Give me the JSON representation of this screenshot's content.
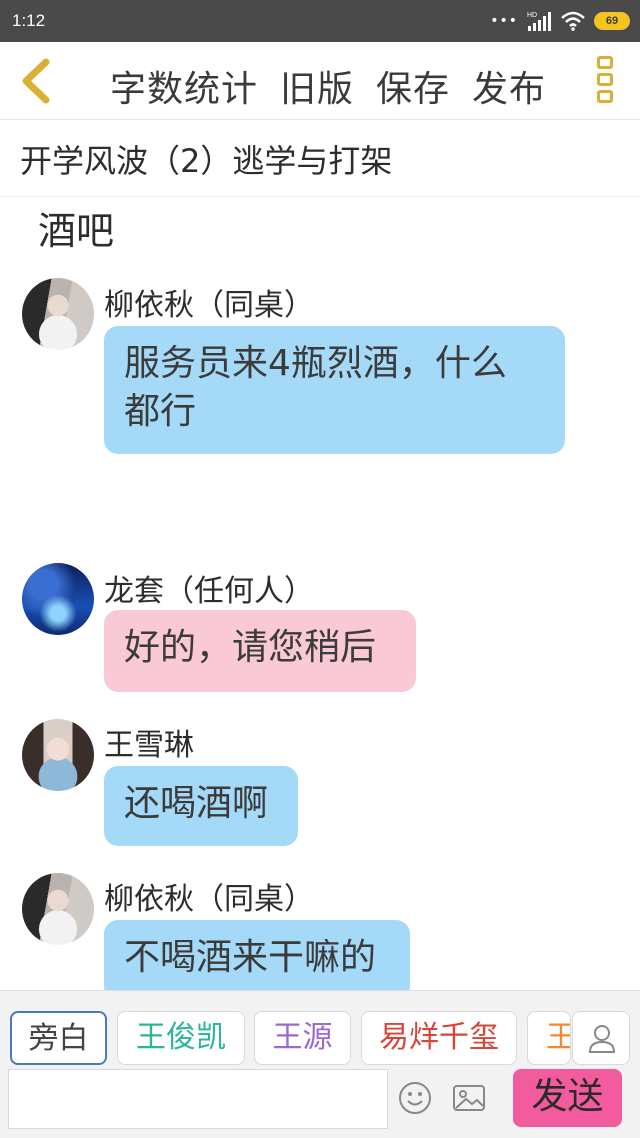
{
  "status_bar": {
    "time": "1:12",
    "signal": "HD",
    "battery": "69"
  },
  "toolbar": {
    "word_count": "字数统计",
    "old_version": "旧版",
    "save": "保存",
    "publish": "发布"
  },
  "chapter": {
    "title": "开学风波（2）逃学与打架"
  },
  "narration": "酒吧",
  "messages": [
    {
      "sender": "柳依秋（同桌）",
      "text": "服务员来4瓶烈酒，什么都行",
      "line1": "服务员来4瓶烈酒，什么",
      "line2": "都行",
      "color": "#a4d9f7"
    },
    {
      "sender": "龙套（任何人）",
      "text": "好的，请您稍后",
      "color": "#f9c9d6"
    },
    {
      "sender": "王雪琳",
      "text": "还喝酒啊",
      "color": "#a4d9f7"
    },
    {
      "sender": "柳依秋（同桌）",
      "text": "不喝酒来干嘛的",
      "color": "#a4d9f7"
    }
  ],
  "role_chips": [
    {
      "label": "旁白",
      "color": "#444444"
    },
    {
      "label": "王俊凯",
      "color": "#2bb59a"
    },
    {
      "label": "王源",
      "color": "#9b6ad0"
    },
    {
      "label": "易烊千玺",
      "color": "#d9443a"
    },
    {
      "label": "王",
      "color": "#f08a30"
    }
  ],
  "input": {
    "placeholder": "",
    "value": ""
  },
  "send_label": "发送"
}
